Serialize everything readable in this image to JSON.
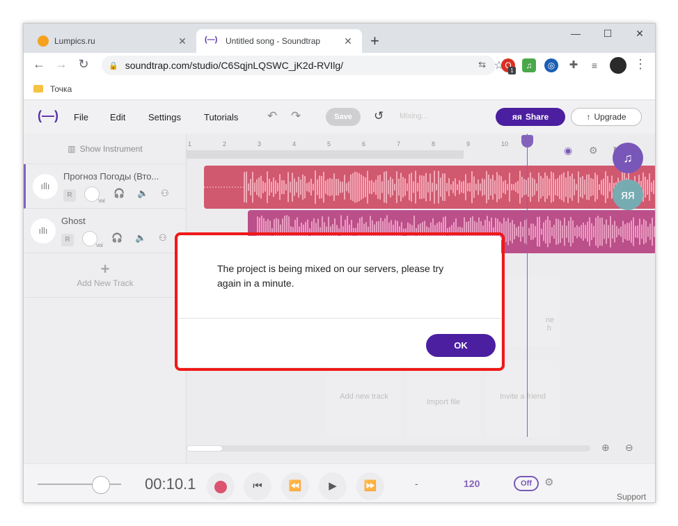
{
  "browser": {
    "tabs": [
      {
        "title": "Lumpics.ru",
        "favicon": "orange-circle-icon"
      },
      {
        "title": "Untitled song - Soundtrap",
        "favicon": "soundtrap-logo-icon"
      }
    ],
    "url": "soundtrap.com/studio/C6SqjnLQSWC_jK2d-RVIlg/",
    "bookmark": "Точка",
    "extension_badge": "1"
  },
  "app": {
    "logo": "(—)",
    "menu": [
      "File",
      "Edit",
      "Settings",
      "Tutorials"
    ],
    "save_label": "Save",
    "mixing_label": "Mixing...",
    "share_label": "Share",
    "upgrade_label": "Upgrade",
    "show_instrument": "Show Instrument",
    "accent": "#5a2ea6"
  },
  "tracks": [
    {
      "name": "Прогноз Погоды (Вто...",
      "clip_color": "#c0213f"
    },
    {
      "name": "Ghost",
      "clip_color": "#a51462"
    }
  ],
  "track_controls": {
    "record": "R",
    "vol": "Vol"
  },
  "add_track_label": "Add New Track",
  "ruler_ticks": [
    "1",
    "2",
    "3",
    "4",
    "5",
    "6",
    "7",
    "8",
    "9",
    "10"
  ],
  "tiles": [
    "Add new track",
    "Import file",
    "Invite a friend"
  ],
  "tile_partial": [
    "ne",
    "h"
  ],
  "transport": {
    "time": "00:10.1",
    "key": "-",
    "tempo": "120",
    "metronome": "Off",
    "support": "Support"
  },
  "dialog": {
    "message": "The project is being mixed on our servers, please try again in a minute.",
    "ok_label": "OK"
  }
}
